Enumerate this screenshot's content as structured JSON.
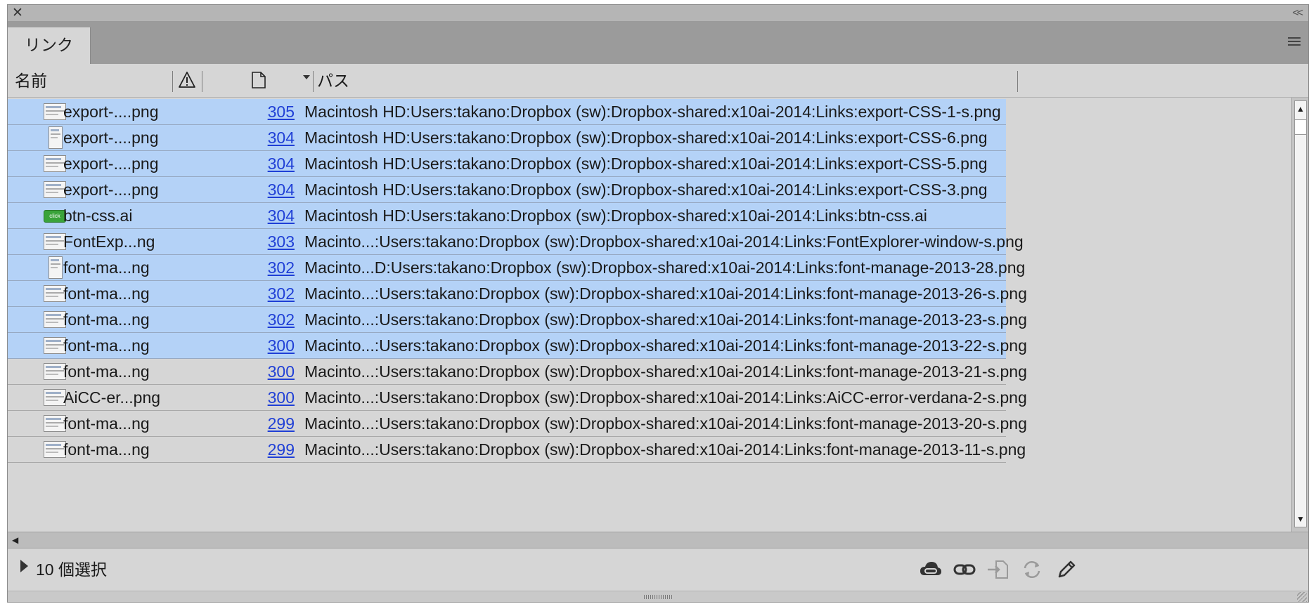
{
  "window": {
    "close_glyph": "✕",
    "collapse_glyph": "<<"
  },
  "tab": {
    "label": "リンク"
  },
  "columns": {
    "name": "名前",
    "path": "パス"
  },
  "rows": [
    {
      "name": "export-....png",
      "page": "305",
      "path": "Macintosh HD:Users:takano:Dropbox (sw):Dropbox-shared:x10ai-2014:Links:export-CSS-1-s.png",
      "selected": true,
      "thumb": "screenshot"
    },
    {
      "name": "export-....png",
      "page": "304",
      "path": "Macintosh HD:Users:takano:Dropbox (sw):Dropbox-shared:x10ai-2014:Links:export-CSS-6.png",
      "selected": true,
      "thumb": "tall"
    },
    {
      "name": "export-....png",
      "page": "304",
      "path": "Macintosh HD:Users:takano:Dropbox (sw):Dropbox-shared:x10ai-2014:Links:export-CSS-5.png",
      "selected": true,
      "thumb": "screenshot"
    },
    {
      "name": "export-....png",
      "page": "304",
      "path": "Macintosh HD:Users:takano:Dropbox (sw):Dropbox-shared:x10ai-2014:Links:export-CSS-3.png",
      "selected": true,
      "thumb": "screenshot"
    },
    {
      "name": "btn-css.ai",
      "page": "304",
      "path": "Macintosh HD:Users:takano:Dropbox (sw):Dropbox-shared:x10ai-2014:Links:btn-css.ai",
      "selected": true,
      "thumb": "green",
      "thumb_text": "click"
    },
    {
      "name": "FontExp...ng",
      "page": "303",
      "path": "Macinto...:Users:takano:Dropbox (sw):Dropbox-shared:x10ai-2014:Links:FontExplorer-window-s.png",
      "selected": true,
      "thumb": "screenshot"
    },
    {
      "name": "font-ma...ng",
      "page": "302",
      "path": "Macinto...D:Users:takano:Dropbox (sw):Dropbox-shared:x10ai-2014:Links:font-manage-2013-28.png",
      "selected": true,
      "thumb": "tall"
    },
    {
      "name": "font-ma...ng",
      "page": "302",
      "path": "Macinto...:Users:takano:Dropbox (sw):Dropbox-shared:x10ai-2014:Links:font-manage-2013-26-s.png",
      "selected": true,
      "thumb": "screenshot"
    },
    {
      "name": "font-ma...ng",
      "page": "302",
      "path": "Macinto...:Users:takano:Dropbox (sw):Dropbox-shared:x10ai-2014:Links:font-manage-2013-23-s.png",
      "selected": true,
      "thumb": "screenshot"
    },
    {
      "name": "font-ma...ng",
      "page": "300",
      "path": "Macinto...:Users:takano:Dropbox (sw):Dropbox-shared:x10ai-2014:Links:font-manage-2013-22-s.png",
      "selected": true,
      "thumb": "screenshot"
    },
    {
      "name": "font-ma...ng",
      "page": "300",
      "path": "Macinto...:Users:takano:Dropbox (sw):Dropbox-shared:x10ai-2014:Links:font-manage-2013-21-s.png",
      "selected": false,
      "thumb": "screenshot"
    },
    {
      "name": "AiCC-er...png",
      "page": "300",
      "path": "Macinto...:Users:takano:Dropbox (sw):Dropbox-shared:x10ai-2014:Links:AiCC-error-verdana-2-s.png",
      "selected": false,
      "thumb": "screenshot"
    },
    {
      "name": "font-ma...ng",
      "page": "299",
      "path": "Macinto...:Users:takano:Dropbox (sw):Dropbox-shared:x10ai-2014:Links:font-manage-2013-20-s.png",
      "selected": false,
      "thumb": "screenshot"
    },
    {
      "name": "font-ma...ng",
      "page": "299",
      "path": "Macinto...:Users:takano:Dropbox (sw):Dropbox-shared:x10ai-2014:Links:font-manage-2013-11-s.png",
      "selected": false,
      "thumb": "screenshot"
    }
  ],
  "footer": {
    "status": "10 個選択"
  },
  "colors": {
    "selected_row": "#b4d2f7",
    "link_text": "#1f3fd6",
    "panel_bg": "#d6d6d6"
  },
  "icons": {
    "footer_buttons": [
      "cloud-link-icon",
      "relink-icon",
      "go-to-link-icon",
      "update-link-icon",
      "edit-original-icon"
    ]
  }
}
